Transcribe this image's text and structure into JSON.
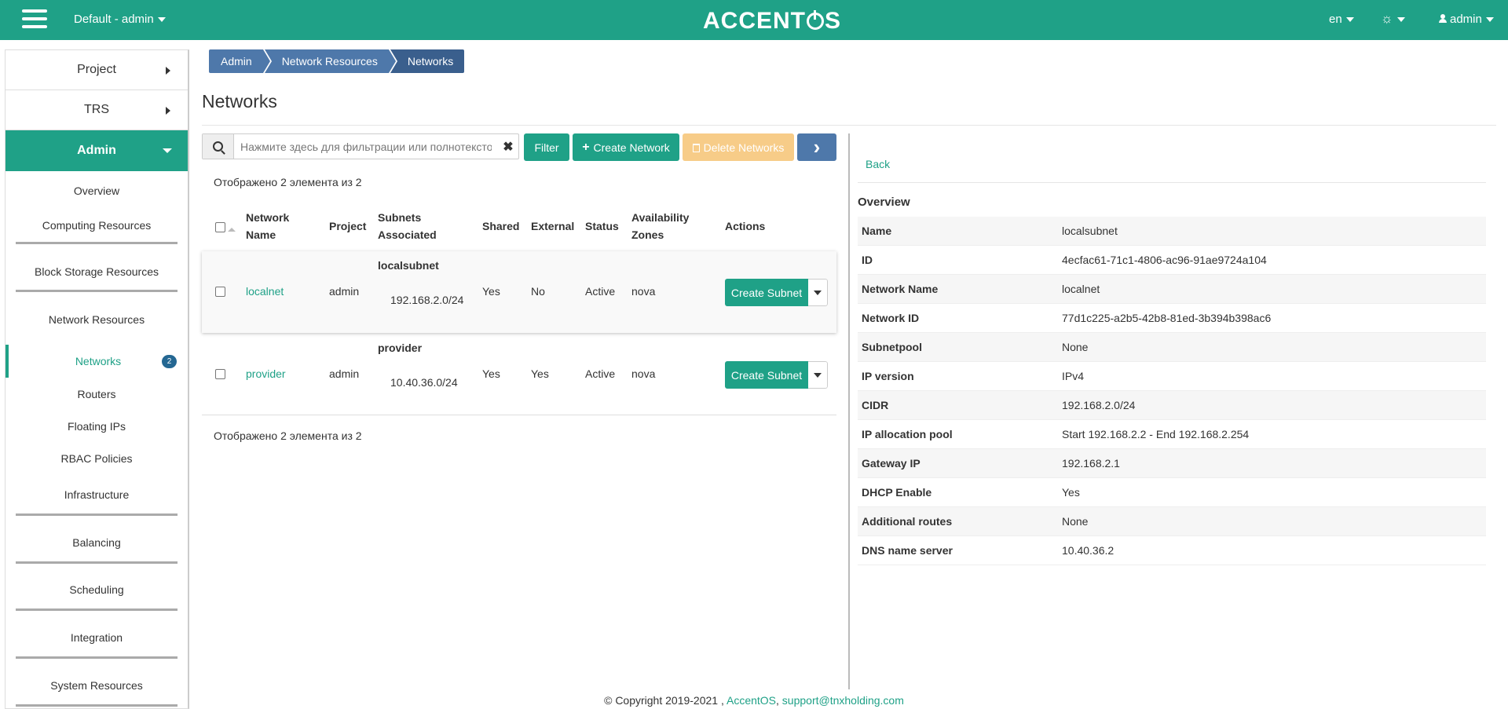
{
  "topbar": {
    "project": "Default - admin",
    "logo": "ACCENTOS",
    "lang": "en",
    "user": "admin"
  },
  "sidebar": {
    "sections": [
      {
        "label": "Project"
      },
      {
        "label": "TRS"
      }
    ],
    "active_section": "Admin",
    "items": [
      {
        "label": "Overview"
      },
      {
        "label": "Computing Resources"
      },
      {
        "label": "Block Storage Resources"
      },
      {
        "label": "Network Resources"
      },
      {
        "label": "Networks",
        "badge": "2"
      },
      {
        "label": "Routers"
      },
      {
        "label": "Floating IPs"
      },
      {
        "label": "RBAC Policies"
      },
      {
        "label": "Infrastructure"
      },
      {
        "label": "Balancing"
      },
      {
        "label": "Scheduling"
      },
      {
        "label": "Integration"
      },
      {
        "label": "System Resources"
      }
    ]
  },
  "breadcrumb": [
    "Admin",
    "Network Resources",
    "Networks"
  ],
  "page_title": "Networks",
  "toolbar": {
    "search_placeholder": "Нажмите здесь для фильтрации или полнотекстов...",
    "filter": "Filter",
    "create": "Create Network",
    "delete": "Delete Networks"
  },
  "table": {
    "count_text": "Отображено 2 элемента из 2",
    "headers": {
      "name_1": "Network",
      "name_2": "Name",
      "project": "Project",
      "subnets_1": "Subnets",
      "subnets_2": "Associated",
      "shared": "Shared",
      "external": "External",
      "status": "Status",
      "zones_1": "Availability",
      "zones_2": "Zones",
      "actions": "Actions"
    },
    "rows": [
      {
        "name": "localnet",
        "project": "admin",
        "subnet_name": "localsubnet",
        "subnet_cidr": "192.168.2.0/24",
        "shared": "Yes",
        "external": "No",
        "status": "Active",
        "zones": "nova",
        "action": "Create Subnet"
      },
      {
        "name": "provider",
        "project": "admin",
        "subnet_name": "provider",
        "subnet_cidr": "10.40.36.0/24",
        "shared": "Yes",
        "external": "Yes",
        "status": "Active",
        "zones": "nova",
        "action": "Create Subnet"
      }
    ]
  },
  "detail": {
    "back": "Back",
    "title": "Overview",
    "rows": [
      {
        "key": "Name",
        "value": "localsubnet"
      },
      {
        "key": "ID",
        "value": "4ecfac61-71c1-4806-ac96-91ae9724a104"
      },
      {
        "key": "Network Name",
        "value": "localnet"
      },
      {
        "key": "Network ID",
        "value": "77d1c225-a2b5-42b8-81ed-3b394b398ac6",
        "link": true
      },
      {
        "key": "Subnetpool",
        "value": "None"
      },
      {
        "key": "IP version",
        "value": "IPv4"
      },
      {
        "key": "CIDR",
        "value": "192.168.2.0/24"
      },
      {
        "key": "IP allocation pool",
        "value": "Start 192.168.2.2 - End 192.168.2.254"
      },
      {
        "key": "Gateway IP",
        "value": "192.168.2.1"
      },
      {
        "key": "DHCP Enable",
        "value": "Yes"
      },
      {
        "key": "Additional routes",
        "value": "None"
      },
      {
        "key": "DNS name server",
        "value": "10.40.36.2"
      }
    ]
  },
  "footer": {
    "copyright": "© Copyright 2019-2021 ,",
    "brand": "AccentOS",
    "sep": ",",
    "email": "support@tnxholding.com"
  },
  "colors": {
    "accent": "#1fa187",
    "breadcrumb": "#4e78aa",
    "warning": "#f7cc88",
    "badge": "#246792"
  }
}
